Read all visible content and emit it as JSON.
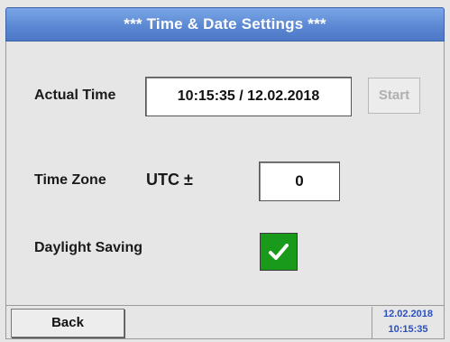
{
  "window": {
    "title": "***   Time & Date Settings   ***"
  },
  "actual_time": {
    "label": "Actual Time",
    "value": "10:15:35 / 12.02.2018",
    "start_label": "Start"
  },
  "time_zone": {
    "label": "Time Zone",
    "utc_label": "UTC ±",
    "value": "0"
  },
  "daylight_saving": {
    "label": "Daylight Saving",
    "checked": true,
    "check_glyph": "✔",
    "check_color": "#1a9a1a"
  },
  "footer": {
    "back_label": "Back",
    "clock_date": "12.02.2018",
    "clock_time": "10:15:35"
  },
  "colors": {
    "title_bar": "#5a86d2",
    "background": "#e6e6e6",
    "clock_text": "#2a4fc0"
  }
}
